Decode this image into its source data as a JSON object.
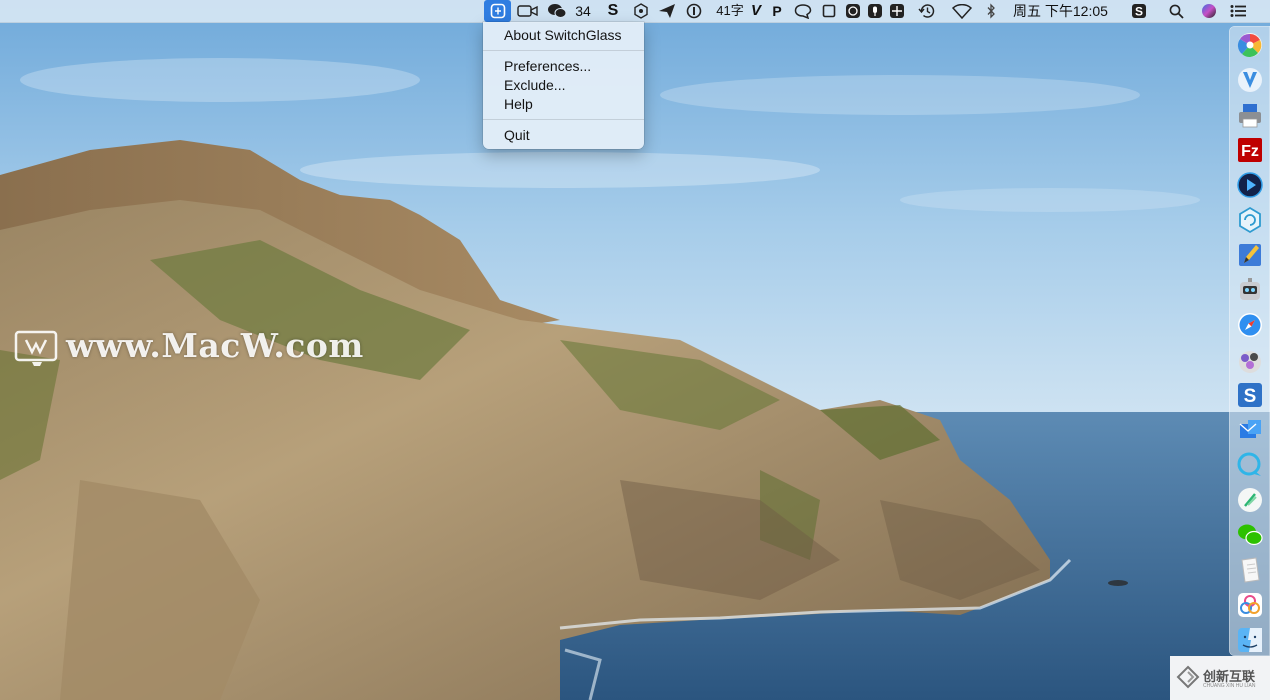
{
  "menubar": {
    "status_items": {
      "wechat_count": "34",
      "word_count": "41字",
      "clock": "周五 下午12:05"
    },
    "icons": [
      "switchglass-icon",
      "facetime-camera-icon",
      "wechat-icon",
      "s-app-icon",
      "hexagon-app-icon",
      "paper-plane-icon",
      "onepassword-icon",
      "vd-app-icon",
      "p-app-icon",
      "chat-bubble-icon",
      "window-square-icon",
      "smile-app-icon",
      "microphone-icon",
      "grid-app-icon",
      "time-machine-icon",
      "wifi-icon",
      "bluetooth-icon",
      "sogou-s-icon",
      "spotlight-search-icon",
      "siri-icon",
      "notification-center-icon"
    ]
  },
  "menu": {
    "items": [
      {
        "label": "About SwitchGlass"
      },
      {
        "label": "Preferences..."
      },
      {
        "label": "Exclude..."
      },
      {
        "label": "Help"
      },
      {
        "label": "Quit"
      }
    ]
  },
  "watermark": {
    "text": "www.MacW.com"
  },
  "dock": {
    "icons": [
      "pinwheel-app-icon",
      "vectorize-app-icon",
      "printer-app-icon",
      "filezilla-icon",
      "video-player-icon",
      "hexagon-refresh-icon",
      "pencil-app-icon",
      "robot-app-icon",
      "safari-icon",
      "media-app-icon",
      "s-app-icon",
      "mail-app-icon",
      "chat-app-icon",
      "feather-app-icon",
      "wechat-icon",
      "document-app-icon",
      "cluster-app-icon",
      "finder-icon"
    ]
  },
  "brand": {
    "text": "创新互联",
    "subtext": "CHUANG XIN HU LIAN"
  },
  "colors": {
    "menubar": "#d6e6f4",
    "menu_highlight": "#2f7de1",
    "sky": "#8dbde3",
    "sea": "#3d6c96"
  }
}
